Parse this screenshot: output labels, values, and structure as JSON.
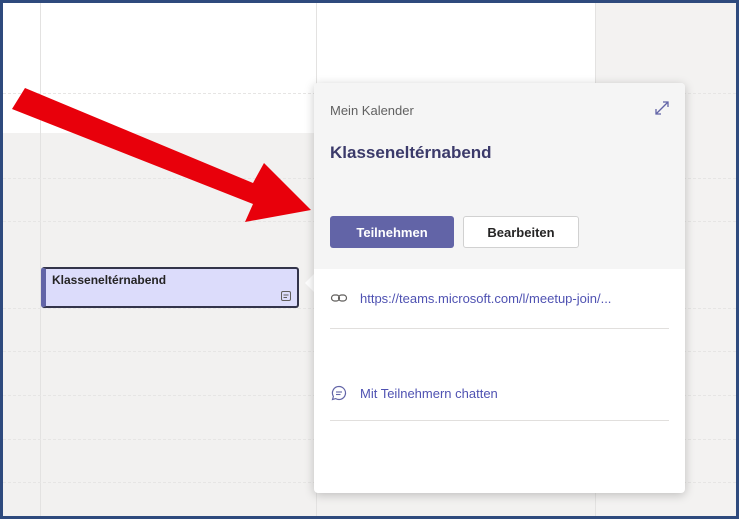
{
  "calendar": {
    "event": {
      "title": "Klasseneltérnabend"
    }
  },
  "popup": {
    "calendar_name": "Mein Kalender",
    "title": "Klasseneltérnabend",
    "join_label": "Teilnehmen",
    "edit_label": "Bearbeiten",
    "meeting_link": "https://teams.microsoft.com/l/meetup-join/...",
    "chat_label": "Mit Teilnehmern chatten"
  },
  "colors": {
    "accent": "#6264a7",
    "event_fill": "#dcdcfb",
    "link": "#4f52b2",
    "arrow": "#e8000b",
    "frame": "#2e4a7d"
  },
  "icons": [
    "expand-icon",
    "link-icon",
    "chat-icon",
    "details-icon"
  ]
}
